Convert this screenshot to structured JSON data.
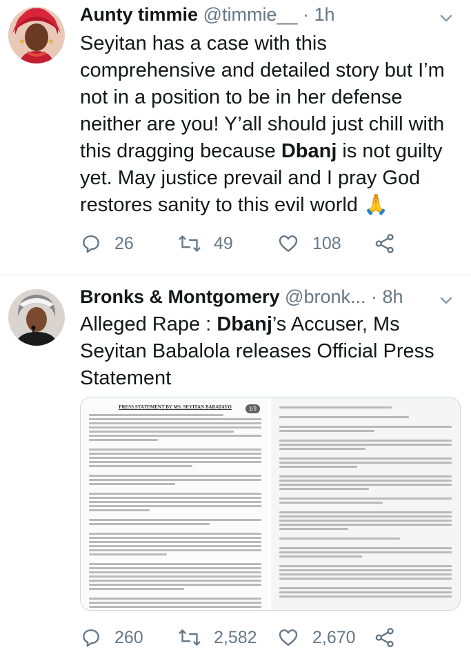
{
  "tweets": [
    {
      "display_name": "Aunty timmie",
      "handle": "@timmie__",
      "separator": "·",
      "time": "1h",
      "text_parts": {
        "a": "Seyitan has a case with this comprehensive and detailed story but I’m not in a position to be in her defense neither are you! Y’all should just chill with this dragging because ",
        "b": "Dbanj",
        "c": " is not guilty yet. May justice prevail and I pray God restores sanity to this evil world 🙏"
      },
      "replies": "26",
      "retweets": "49",
      "likes": "108"
    },
    {
      "display_name": "Bronks & Montgomery",
      "handle": "@bronk...",
      "separator": "·",
      "time": "8h",
      "text_parts": {
        "a": "Alleged Rape : ",
        "b": "Dbanj",
        "c": "’s Accuser, Ms Seyitan Babalola releases Official Press Statement"
      },
      "media": {
        "doc_title": "PRESS STATEMENT BY MS. SEYITAN BABATAYO",
        "page_badge": "1/3"
      },
      "replies": "260",
      "retweets": "2,582",
      "likes": "2,670"
    }
  ],
  "icons": {
    "reply": "reply-icon",
    "retweet": "retweet-icon",
    "like": "heart-icon",
    "share": "share-icon",
    "more": "chevron-down-icon"
  },
  "colors": {
    "text": "#14171a",
    "secondary": "#657786",
    "divider": "#e1e8ed"
  }
}
